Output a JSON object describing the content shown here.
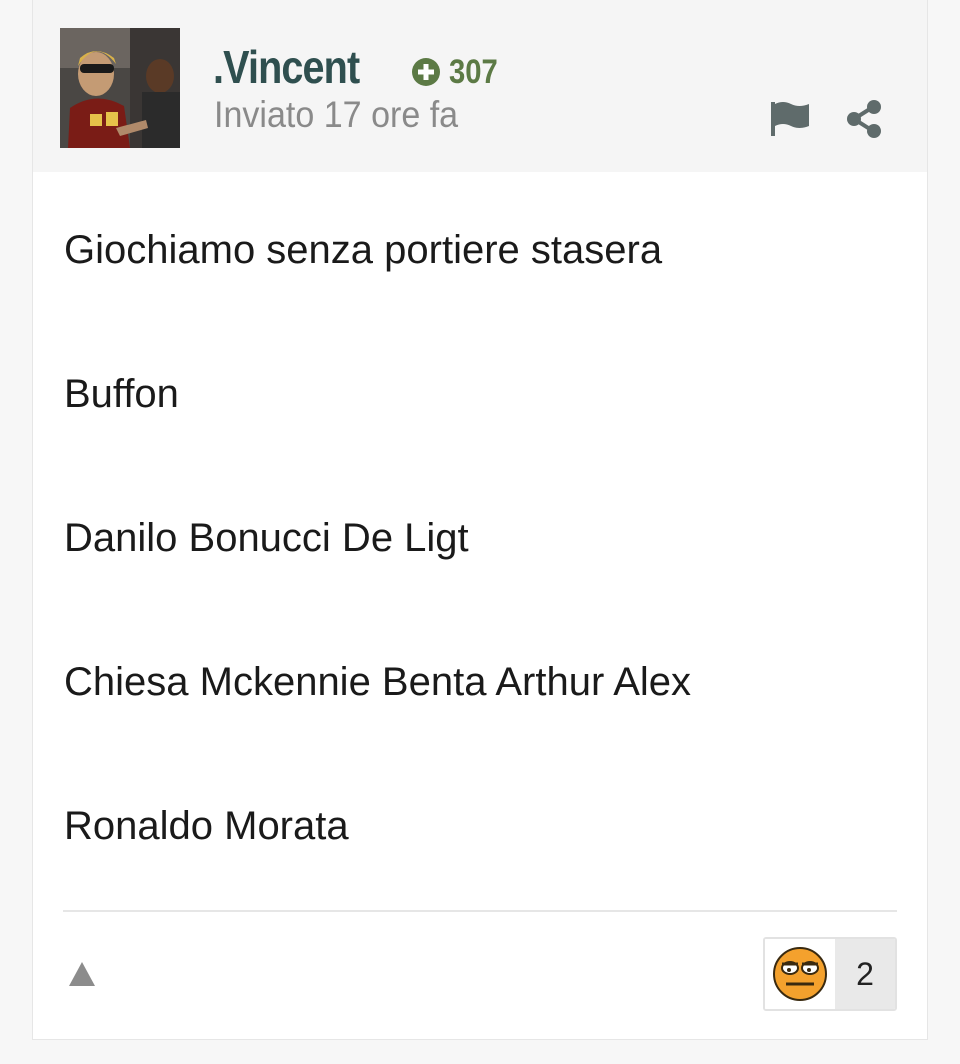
{
  "post": {
    "author": {
      "name": ".Vincent",
      "reputation": "307",
      "posted": "Inviato 17 ore fa"
    },
    "actions": {
      "report_icon": "flag-icon",
      "share_icon": "share-icon"
    },
    "content": {
      "lines": [
        "Giochiamo senza portiere stasera",
        "Buffon",
        "Danilo Bonucci De Ligt",
        "Chiesa Mckennie Benta Arthur Alex",
        "Ronaldo Morata"
      ]
    },
    "footer": {
      "upvote_icon": "triangle-up-icon",
      "reaction": {
        "icon": "reaction-face-icon",
        "count": "2"
      }
    },
    "colors": {
      "username": "#2f4f4f",
      "reputation": "#5c7a45",
      "header_bg": "#f5f5f5",
      "muted_text": "#8a8a8a"
    }
  }
}
